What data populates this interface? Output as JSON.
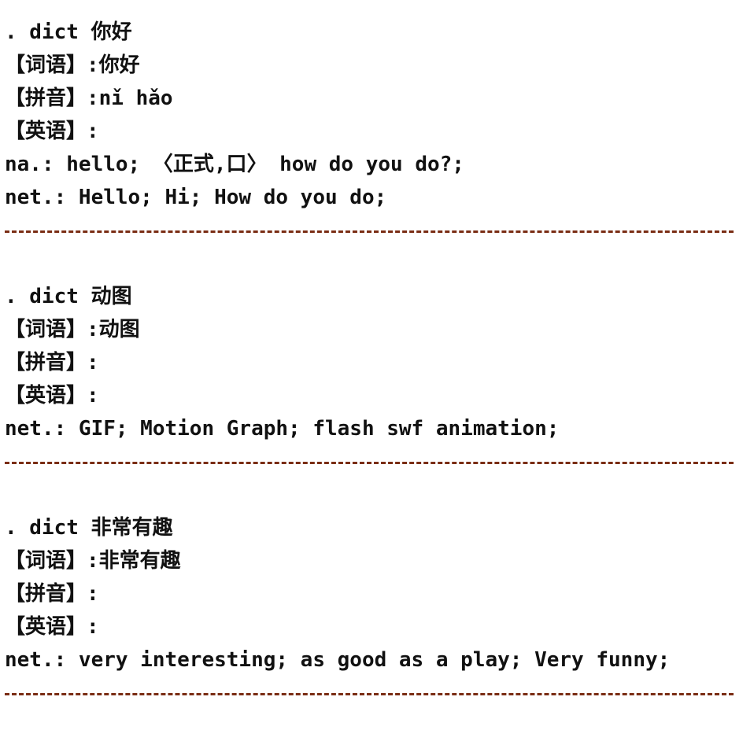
{
  "colors": {
    "text": "#111111",
    "separator": "#7a2d14",
    "background": "#ffffff"
  },
  "entries": [
    {
      "command": ". dict 你好",
      "word_line": "【词语】:你好",
      "pinyin_line": "【拼音】:nǐ hǎo",
      "english_line": "【英语】:",
      "definitions": [
        "na.: hello; 〈正式,口〉 how do you do?;",
        "net.: Hello; Hi; How do you do;"
      ]
    },
    {
      "command": ". dict 动图",
      "word_line": "【词语】:动图",
      "pinyin_line": "【拼音】:",
      "english_line": "【英语】:",
      "definitions": [
        "net.: GIF; Motion Graph; flash swf animation;"
      ]
    },
    {
      "command": ". dict 非常有趣",
      "word_line": "【词语】:非常有趣",
      "pinyin_line": "【拼音】:",
      "english_line": "【英语】:",
      "definitions": [
        "net.: very interesting; as good as a play; Very funny;"
      ]
    }
  ]
}
